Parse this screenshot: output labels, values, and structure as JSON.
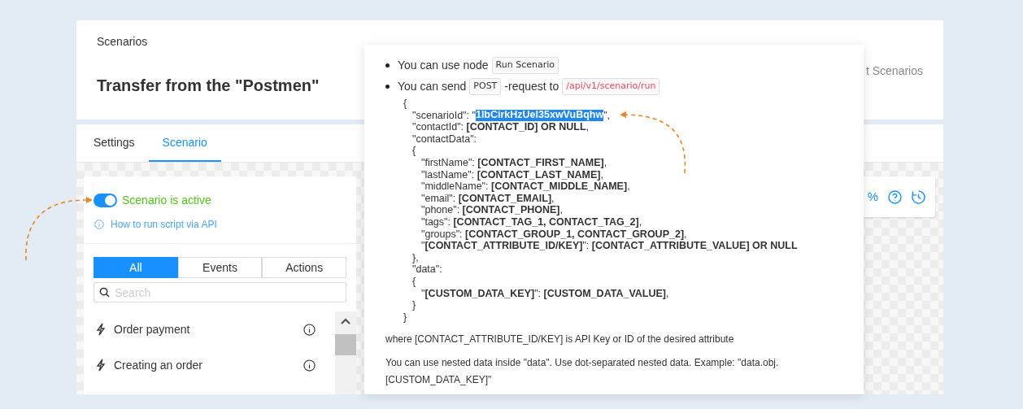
{
  "header": {
    "breadcrumb": "Scenarios",
    "title": "Transfer from the \"Postmen\"",
    "right_link": "t Scenarios"
  },
  "tabs": [
    {
      "label": "Settings",
      "selected": false
    },
    {
      "label": "Scenario",
      "selected": true
    }
  ],
  "toolbar": {
    "zoom": "%"
  },
  "panel": {
    "active": {
      "on": true,
      "label": "Scenario is active"
    },
    "api_link": "How to run script via API",
    "filters": [
      {
        "label": "All",
        "selected": true
      },
      {
        "label": "Events",
        "selected": false
      },
      {
        "label": "Actions",
        "selected": false
      }
    ],
    "search": {
      "placeholder": "Search"
    },
    "items": [
      {
        "label": "Order payment"
      },
      {
        "label": "Creating an order"
      }
    ]
  },
  "popover": {
    "bullets": [
      [
        {
          "kind": "text",
          "text": "You can use node"
        },
        {
          "kind": "chip",
          "text": "Run Scenario"
        }
      ],
      [
        {
          "kind": "text",
          "text": "You can send"
        },
        {
          "kind": "chip",
          "text": "POST"
        },
        {
          "kind": "text",
          "text": "-request to"
        },
        {
          "kind": "url",
          "text": "/api/v1/scenario/run"
        }
      ]
    ],
    "code": [
      {
        "text": "{",
        "children": [
          {
            "kind": "highlight",
            "before": "\"scenarioId\": \"",
            "value": "1lbCirkHzUel35xwVuBqhw",
            "after": "\","
          },
          {
            "text": "\"contactId\": **[CONTACT_ID] OR NULL**,"
          },
          {
            "text": "\"contactData\":"
          },
          {
            "text": "{",
            "children": [
              {
                "text": "\"firstName\": **[CONTACT_FIRST_NAME]**,"
              },
              {
                "text": "\"lastName\": **[CONTACT_LAST_NAME]**,"
              },
              {
                "text": "\"middleName\": **[CONTACT_MIDDLE_NAME]**,"
              },
              {
                "text": "\"email\": **[CONTACT_EMAIL]**,"
              },
              {
                "text": "\"phone\": **[CONTACT_PHONE]**,"
              },
              {
                "text": "\"tags\": **[CONTACT_TAG_1, CONTACT_TAG_2]**,"
              },
              {
                "text": "\"groups\": **[CONTACT_GROUP_1, CONTACT_GROUP_2]**,"
              },
              {
                "text": "\"**[CONTACT_ATTRIBUTE_ID/KEY]**\": **[CONTACT_ATTRIBUTE_VALUE] OR NULL**"
              }
            ]
          },
          {
            "text": "},"
          },
          {
            "text": "\"data\":"
          },
          {
            "text": "{",
            "children": [
              {
                "text": "\"**[CUSTOM_DATA_KEY]**\": **[CUSTOM_DATA_VALUE]**,"
              }
            ]
          },
          {
            "text": "}"
          }
        ]
      },
      {
        "text": "}"
      }
    ],
    "notes": [
      "where [CONTACT_ATTRIBUTE_ID/KEY] is API Key or ID of the desired attribute",
      "You can use nested data inside \"data\". Use dot-separated nested data. Example: \"data.obj.[CUSTOM_DATA_KEY]\""
    ]
  }
}
